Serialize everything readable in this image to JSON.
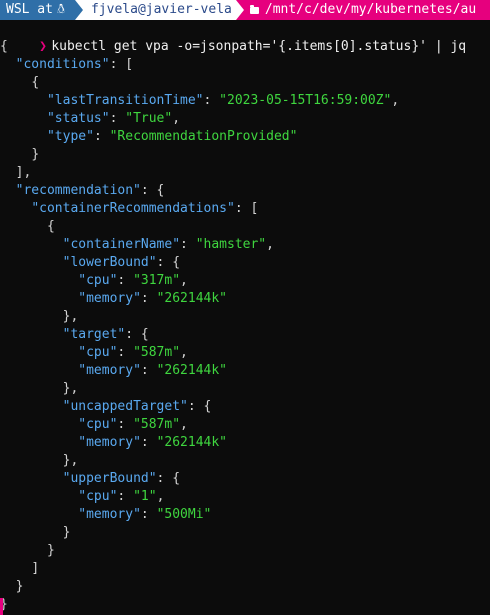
{
  "prompt": {
    "os_label": "WSL at",
    "os_icon": "penguin-icon",
    "user_host": "fjvela@javier-vela",
    "path": "/mnt/c/dev/my/kubernetes/au"
  },
  "command": "kubectl get vpa -o=jsonpath='{.items[0].status}' | jq",
  "output": {
    "open_brace": "{",
    "conditions_key": "\"conditions\"",
    "cond_open": "{",
    "ltt_key": "\"lastTransitionTime\"",
    "ltt_val": "\"2023-05-15T16:59:00Z\"",
    "status_key": "\"status\"",
    "status_val": "\"True\"",
    "type_key": "\"type\"",
    "type_val": "\"RecommendationProvided\"",
    "cond_close": "}",
    "conditions_close": "],",
    "recommendation_key": "\"recommendation\"",
    "container_recs_key": "\"containerRecommendations\"",
    "rec_open": "{",
    "container_name_key": "\"containerName\"",
    "container_name_val": "\"hamster\"",
    "lower_bound_key": "\"lowerBound\"",
    "lb_cpu_key": "\"cpu\"",
    "lb_cpu_val": "\"317m\"",
    "lb_mem_key": "\"memory\"",
    "lb_mem_val": "\"262144k\"",
    "lb_close": "},",
    "target_key": "\"target\"",
    "t_cpu_key": "\"cpu\"",
    "t_cpu_val": "\"587m\"",
    "t_mem_key": "\"memory\"",
    "t_mem_val": "\"262144k\"",
    "t_close": "},",
    "uncapped_key": "\"uncappedTarget\"",
    "u_cpu_key": "\"cpu\"",
    "u_cpu_val": "\"587m\"",
    "u_mem_key": "\"memory\"",
    "u_mem_val": "\"262144k\"",
    "u_close": "},",
    "upper_bound_key": "\"upperBound\"",
    "ub_cpu_key": "\"cpu\"",
    "ub_cpu_val": "\"1\"",
    "ub_mem_key": "\"memory\"",
    "ub_mem_val": "\"500Mi\"",
    "ub_close": "}",
    "rec_close": "}",
    "recs_close": "]",
    "recommendation_close": "}",
    "close_brace": "}"
  },
  "colors": {
    "background": "#0c0c0c",
    "key": "#5aa9f0",
    "string": "#3fd63f",
    "punct": "#d4d4d4",
    "accent": "#e6007e",
    "os_segment": "#2f6fa8"
  }
}
